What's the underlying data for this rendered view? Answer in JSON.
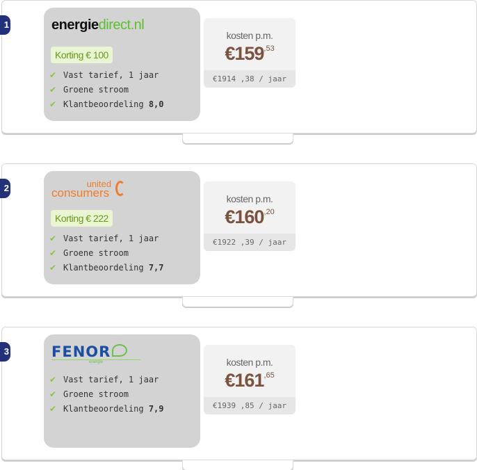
{
  "offers": [
    {
      "rank": "1",
      "provider": "energiedirect.nl",
      "logo_parts": [
        "energie",
        "direct.nl"
      ],
      "korting": "Korting € 100",
      "features": [
        "Vast tarief, 1 jaar",
        "Groene stroom"
      ],
      "rating_label": "Klantbeoordeling",
      "rating": "8,0",
      "cost_label": "kosten p.m.",
      "price_main": "€159",
      "price_cents": ",53",
      "yearly": "€1914 ,38 / jaar"
    },
    {
      "rank": "2",
      "provider": "united consumers",
      "logo_parts": [
        "united",
        "consumers"
      ],
      "korting": "Korting € 222",
      "features": [
        "Vast tarief, 1 jaar",
        "Groene stroom"
      ],
      "rating_label": "Klantbeoordeling",
      "rating": "7,7",
      "cost_label": "kosten p.m.",
      "price_main": "€160",
      "price_cents": ",20",
      "yearly": "€1922 ,39 / jaar"
    },
    {
      "rank": "3",
      "provider": "FENOR energie",
      "logo_parts": [
        "FENOR",
        "energie"
      ],
      "korting": null,
      "features": [
        "Vast tarief, 1 jaar",
        "Groene stroom"
      ],
      "rating_label": "Klantbeoordeling",
      "rating": "7,9",
      "cost_label": "kosten p.m.",
      "price_main": "€161",
      "price_cents": ",65",
      "yearly": "€1939 ,85 / jaar"
    }
  ],
  "colors": {
    "rank_badge": "#23307a",
    "price": "#7a5240",
    "check": "#8bc34a",
    "korting_bg": "#e9f5d3",
    "korting_text": "#6a9a1a",
    "energiedirect_green": "#5cc02c",
    "united_orange": "#f07c2c",
    "fenor_blue": "#1d4fa0"
  }
}
